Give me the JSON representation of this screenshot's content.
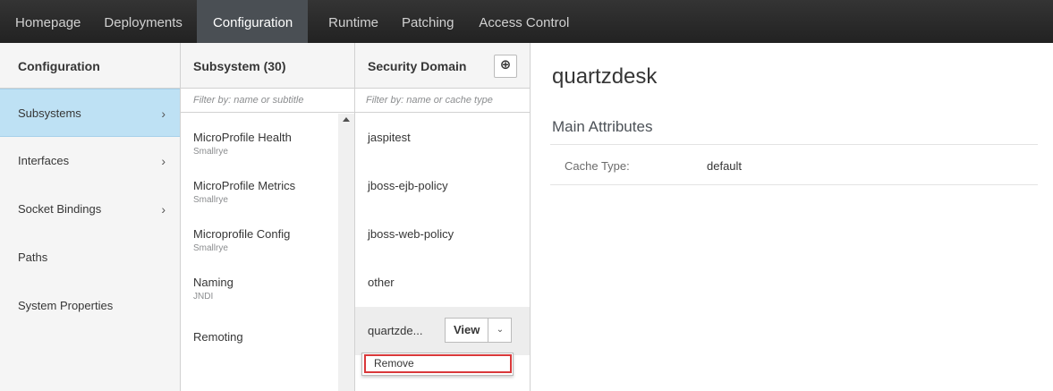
{
  "topnav": {
    "items": [
      {
        "label": "Homepage"
      },
      {
        "label": "Deployments"
      },
      {
        "label": "Configuration"
      },
      {
        "label": "Runtime"
      },
      {
        "label": "Patching"
      },
      {
        "label": "Access Control"
      }
    ],
    "active": "Configuration"
  },
  "config_column": {
    "title": "Configuration",
    "items": [
      {
        "label": "Subsystems",
        "chevron": "›"
      },
      {
        "label": "Interfaces",
        "chevron": "›"
      },
      {
        "label": "Socket Bindings",
        "chevron": "›"
      },
      {
        "label": "Paths"
      },
      {
        "label": "System Properties"
      }
    ]
  },
  "subsystem_column": {
    "title": "Subsystem (30)",
    "filter_placeholder": "Filter by: name or subtitle",
    "items": [
      {
        "title": "MicroProfile Health",
        "subtitle": "Smallrye"
      },
      {
        "title": "MicroProfile Metrics",
        "subtitle": "Smallrye"
      },
      {
        "title": "Microprofile Config",
        "subtitle": "Smallrye"
      },
      {
        "title": "Naming",
        "subtitle": "JNDI"
      },
      {
        "title": "Remoting"
      }
    ]
  },
  "security_column": {
    "title": "Security Domain",
    "add_icon": "⊕",
    "filter_placeholder": "Filter by: name or cache type",
    "items": [
      {
        "label": "jaspitest"
      },
      {
        "label": "jboss-ejb-policy"
      },
      {
        "label": "jboss-web-policy"
      },
      {
        "label": "other"
      },
      {
        "label": "quartzde..."
      }
    ],
    "view_label": "View",
    "dropdown_icon": "⌄",
    "menu": {
      "remove_label": "Remove"
    }
  },
  "detail": {
    "title": "quartzdesk",
    "section": "Main Attributes",
    "attributes": [
      {
        "label": "Cache Type:",
        "value": "default"
      }
    ]
  },
  "colors": {
    "nav_bg": "#2b2b2b",
    "nav_active": "#4a4f54",
    "selected_bg": "#bee1f4",
    "highlight_border": "#d9383a"
  }
}
